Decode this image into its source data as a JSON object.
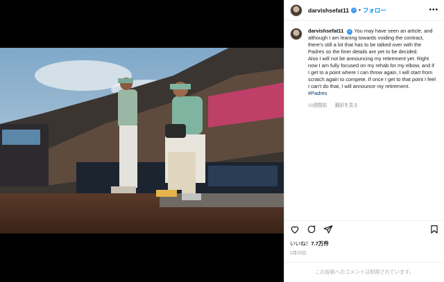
{
  "post": {
    "username": "darvishsefat11",
    "follow_label": "フォロー",
    "more_label": "•••",
    "caption_username": "darvishsefat11",
    "caption_lines": [
      "You may have seen an article, and although I am leaning towards voiding the contract, there's still a lot that has to be talked over with the Padres so the finer details are yet to be decided.",
      "Also I will not be announcing my retirement yet. Right now I am fully focused on my rehab for my elbow, and if I get to a point where I can throw again, I will start from scratch again to compete. If once I get to that point I feel I can't do that, I will announce my retirement."
    ],
    "hashtag": "#Padres",
    "time_ago": "10週間前",
    "translate_label": "翻訳を見る",
    "likes_prefix": "いいね！",
    "likes_count": "7.7万件",
    "date": "1月25日",
    "comments_disabled": "この投稿へのコメントは制限されています。"
  },
  "icons": [
    "heart-icon",
    "comment-icon",
    "share-icon",
    "bookmark-icon",
    "verified-badge-icon"
  ],
  "colors": {
    "link": "#0095f6",
    "hashtag": "#00376b",
    "verified": "#3897f0",
    "muted": "#8e8e8e"
  }
}
